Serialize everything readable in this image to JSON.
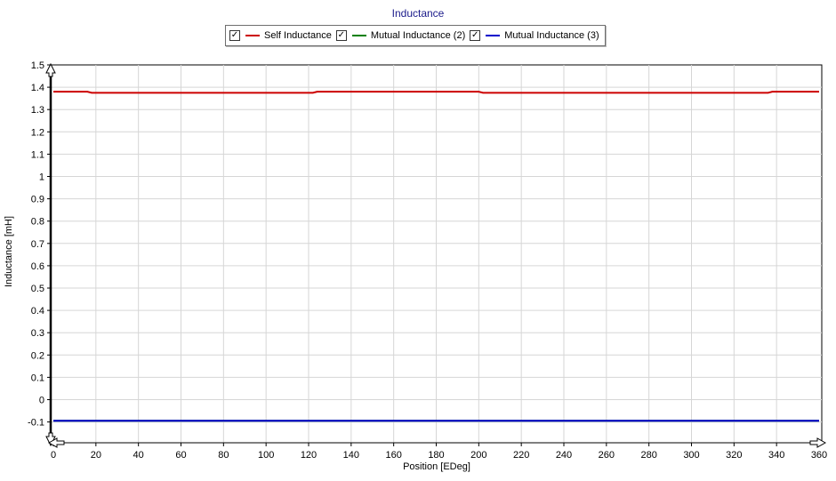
{
  "chart_data": {
    "type": "line",
    "title": "Inductance",
    "xlabel": "Position [EDeg]",
    "ylabel": "Inductance [mH]",
    "xlim": [
      0,
      360
    ],
    "ylim": [
      -0.15,
      1.5
    ],
    "x_ticks": [
      "0",
      "20",
      "40",
      "60",
      "80",
      "100",
      "120",
      "140",
      "160",
      "180",
      "200",
      "220",
      "240",
      "260",
      "280",
      "300",
      "320",
      "340",
      "360"
    ],
    "y_ticks": [
      "1.5",
      "1.4",
      "1.3",
      "1.2",
      "1.1",
      "1",
      "0.9",
      "0.8",
      "0.7",
      "0.6",
      "0.5",
      "0.4",
      "0.3",
      "0.2",
      "0.1",
      "0",
      "-0.1"
    ],
    "grid": true,
    "legend_position": "top-center",
    "series": [
      {
        "name": "Self Inductance",
        "color": "#cc0000",
        "checked": true,
        "x": [
          0,
          16,
          18,
          122,
          124,
          200,
          202,
          336,
          338,
          360
        ],
        "y": [
          1.38,
          1.38,
          1.375,
          1.375,
          1.38,
          1.38,
          1.375,
          1.375,
          1.38,
          1.38
        ]
      },
      {
        "name": "Mutual Inductance (2)",
        "color": "#008000",
        "checked": true,
        "x": [
          0,
          360
        ],
        "y": [
          -0.095,
          -0.095
        ]
      },
      {
        "name": "Mutual Inductance (3)",
        "color": "#0000cc",
        "checked": true,
        "x": [
          0,
          360
        ],
        "y": [
          -0.095,
          -0.095
        ]
      }
    ]
  }
}
